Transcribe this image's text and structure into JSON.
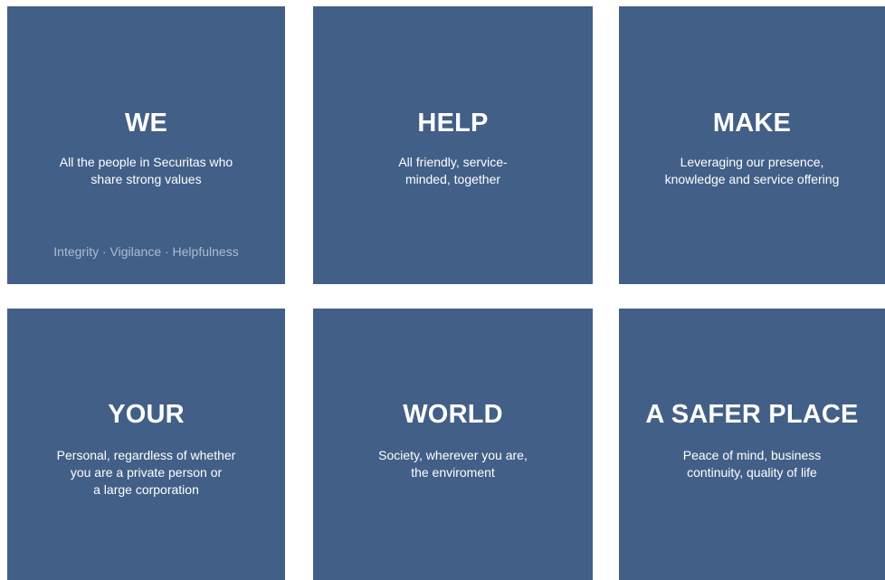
{
  "tiles": [
    {
      "heading": "WE",
      "lines": [
        "All the people in Securitas who",
        "share strong values"
      ],
      "values": "Integrity · Vigilance · Helpfulness"
    },
    {
      "heading": "HELP",
      "lines": [
        "All friendly, service-",
        "minded, together"
      ]
    },
    {
      "heading": "MAKE",
      "lines": [
        "Leveraging our presence,",
        "knowledge and service offering"
      ]
    },
    {
      "heading": "YOUR",
      "lines": [
        "Personal, regardless of whether",
        "you are a private person or",
        "a large corporation"
      ]
    },
    {
      "heading": "WORLD",
      "lines": [
        "Society, wherever you are,",
        "the enviroment"
      ]
    },
    {
      "heading": "A SAFER PLACE",
      "lines": [
        "Peace of mind, business",
        "continuity, quality of life"
      ]
    }
  ],
  "colors": {
    "tile_background": "#425f87",
    "text": "#ffffff",
    "muted_text": "#aebcd1"
  }
}
